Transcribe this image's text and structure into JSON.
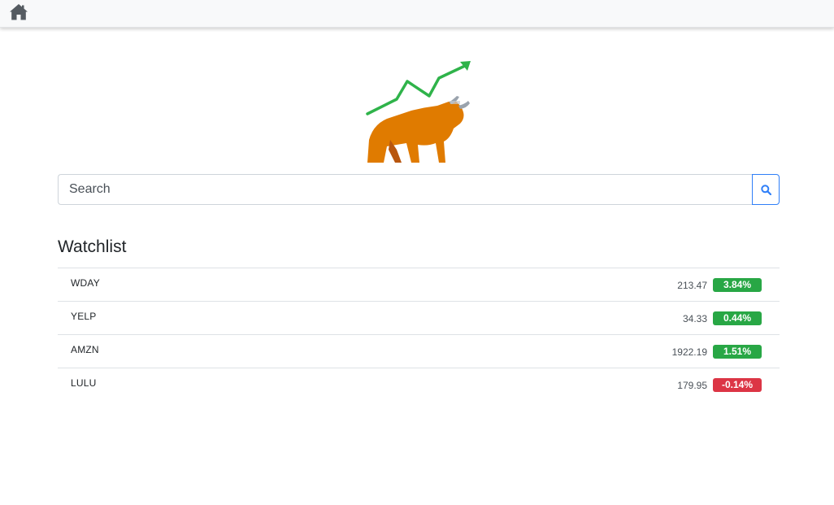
{
  "nav": {
    "home_icon": "home-icon"
  },
  "logo": {
    "icon": "bull-with-rising-chart-logo",
    "colors": {
      "chart": "#2fb34a",
      "bull": "#e07b00",
      "horn": "#9aa3ad"
    }
  },
  "search": {
    "placeholder": "Search",
    "value": "",
    "button_icon": "search-icon",
    "accent": "#2f7ff8"
  },
  "watchlist": {
    "title": "Watchlist",
    "items": [
      {
        "symbol": "WDAY",
        "price": "213.47",
        "change": "3.84%",
        "direction": "up"
      },
      {
        "symbol": "YELP",
        "price": "34.33",
        "change": "0.44%",
        "direction": "up"
      },
      {
        "symbol": "AMZN",
        "price": "1922.19",
        "change": "1.51%",
        "direction": "up"
      },
      {
        "symbol": "LULU",
        "price": "179.95",
        "change": "-0.14%",
        "direction": "down"
      }
    ],
    "colors": {
      "up": "#28a745",
      "down": "#dc3545"
    }
  }
}
